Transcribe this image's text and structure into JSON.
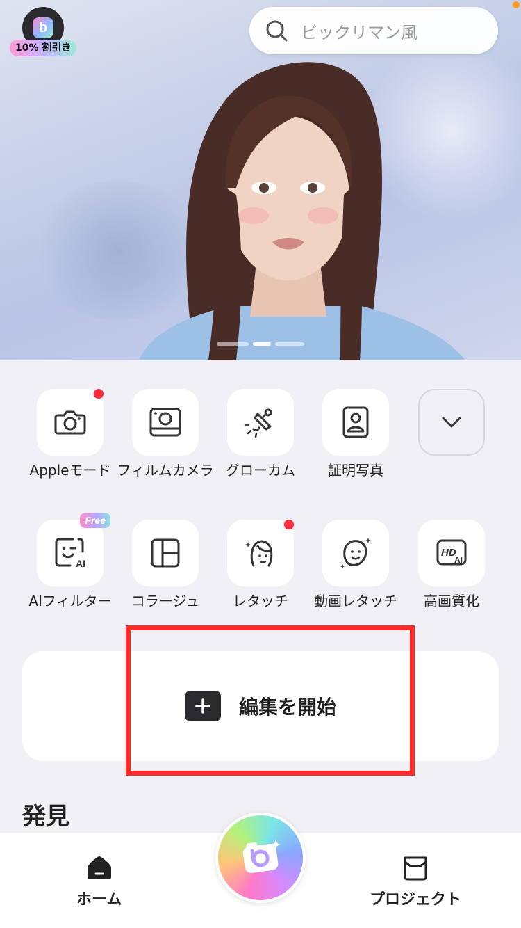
{
  "promo": {
    "badge": "10% 割引き"
  },
  "search": {
    "placeholder": "ビックリマン風"
  },
  "tools_row1": [
    {
      "label": "Appleモード",
      "icon": "camera-icon",
      "new": true
    },
    {
      "label": "フィルムカメラ",
      "icon": "film-camera-icon",
      "new": false
    },
    {
      "label": "グローカム",
      "icon": "glow-light-icon",
      "new": false
    },
    {
      "label": "証明写真",
      "icon": "id-photo-icon",
      "new": false
    },
    {
      "label": "",
      "icon": "chevron-down-icon",
      "new": false
    }
  ],
  "tools_row2": [
    {
      "label": "AIフィルター",
      "icon": "ai-filter-icon",
      "badge": "Free"
    },
    {
      "label": "コラージュ",
      "icon": "collage-icon"
    },
    {
      "label": "レタッチ",
      "icon": "retouch-icon",
      "new": true
    },
    {
      "label": "動画レタッチ",
      "icon": "video-retouch-icon"
    },
    {
      "label": "高画質化",
      "icon": "hd-ai-icon",
      "hd_text": "HD",
      "ai_text": "AI"
    }
  ],
  "ai_filter_icon_text": "AI",
  "start_edit": {
    "label": "編集を開始"
  },
  "discover": {
    "title": "発見"
  },
  "nav": {
    "home": "ホーム",
    "projects": "プロジェクト"
  },
  "colors": {
    "accent_red": "#ff2a3a",
    "highlight": "#ff2a2a",
    "orange_dot": "#ff9a1a"
  },
  "carousel": {
    "count": 3,
    "active": 2
  }
}
